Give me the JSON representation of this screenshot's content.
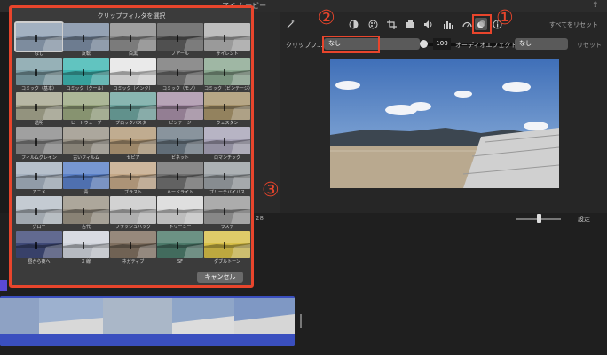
{
  "window": {
    "title": "アイ ムービー"
  },
  "viewer": {
    "reset_all_label": "すべてをリセット",
    "clip_filter_label": "クリップフ...",
    "clip_filter_value": "なし",
    "intensity_value": "100",
    "audio_effect_label": "オーディオエフェクト:",
    "audio_effect_value": "なし",
    "reset_label": "リセット",
    "tool_icons": [
      "magic-wand-icon",
      "color-balance-icon",
      "color-palette-icon",
      "crop-icon",
      "camera-icon",
      "volume-icon",
      "equalizer-icon",
      "speed-gauge-icon",
      "clip-filter-icon",
      "info-icon"
    ]
  },
  "timeline": {
    "time_code": "28",
    "settings_label": "設定"
  },
  "dialog": {
    "title": "クリップフィルタを選択",
    "cancel_label": "キャンセル",
    "filters": [
      {
        "label": "なし",
        "tint": "#8fa0b4",
        "selected": true
      },
      {
        "label": "反転",
        "tint": "#7d8ea4"
      },
      {
        "label": "白黒",
        "tint": "#8c8c8c"
      },
      {
        "label": "ノアール",
        "tint": "#5c5c5c"
      },
      {
        "label": "サイレント",
        "tint": "#b0b0b0"
      },
      {
        "label": "コミック（基本）",
        "tint": "#7fa0a8"
      },
      {
        "label": "コミック（クール）",
        "tint": "#3fb7b2"
      },
      {
        "label": "コミック（インク）",
        "tint": "#e6e6e6"
      },
      {
        "label": "コミック（モノ）",
        "tint": "#777777"
      },
      {
        "label": "コミック（ビンテージ）",
        "tint": "#8aa890"
      },
      {
        "label": "透明",
        "tint": "#a8a890"
      },
      {
        "label": "ヒートウェーブ",
        "tint": "#9aa880"
      },
      {
        "label": "ブロックバスター",
        "tint": "#6fa6a0"
      },
      {
        "label": "ビンテージ",
        "tint": "#a890a8"
      },
      {
        "label": "ウェスタン",
        "tint": "#a8946c"
      },
      {
        "label": "フィルムグレイン",
        "tint": "#8c8c8c"
      },
      {
        "label": "古いフィルム",
        "tint": "#9a9488"
      },
      {
        "label": "セピア",
        "tint": "#b39a78"
      },
      {
        "label": "ビネット",
        "tint": "#6f7d88"
      },
      {
        "label": "ロマンチック",
        "tint": "#a8a4b8"
      },
      {
        "label": "アニメ",
        "tint": "#a6b2c0"
      },
      {
        "label": "青",
        "tint": "#5a80c8"
      },
      {
        "label": "ブラスト",
        "tint": "#c4a888"
      },
      {
        "label": "ハードライト",
        "tint": "#707070"
      },
      {
        "label": "ブリーチバイパス",
        "tint": "#9aa0a4"
      },
      {
        "label": "グロー",
        "tint": "#b8c0c8"
      },
      {
        "label": "古代",
        "tint": "#9c9486"
      },
      {
        "label": "フラッシュバック",
        "tint": "#c8c8c8"
      },
      {
        "label": "ドリーミー",
        "tint": "#d8d8d8"
      },
      {
        "label": "ラステ",
        "tint": "#9a9a9a"
      },
      {
        "label": "昼から夜へ",
        "tint": "#404a78"
      },
      {
        "label": "X 線",
        "tint": "#d0d4dc"
      },
      {
        "label": "ネガティブ",
        "tint": "#807060"
      },
      {
        "label": "SF",
        "tint": "#4c7a6a"
      },
      {
        "label": "ダブルトーン",
        "tint": "#d8c048"
      }
    ]
  },
  "callouts": [
    "①",
    "②",
    "③"
  ],
  "colors": {
    "accent": "#e8452c",
    "dialog_bg": "#3b3b3b",
    "clip_strip": "#3a4fbf"
  }
}
